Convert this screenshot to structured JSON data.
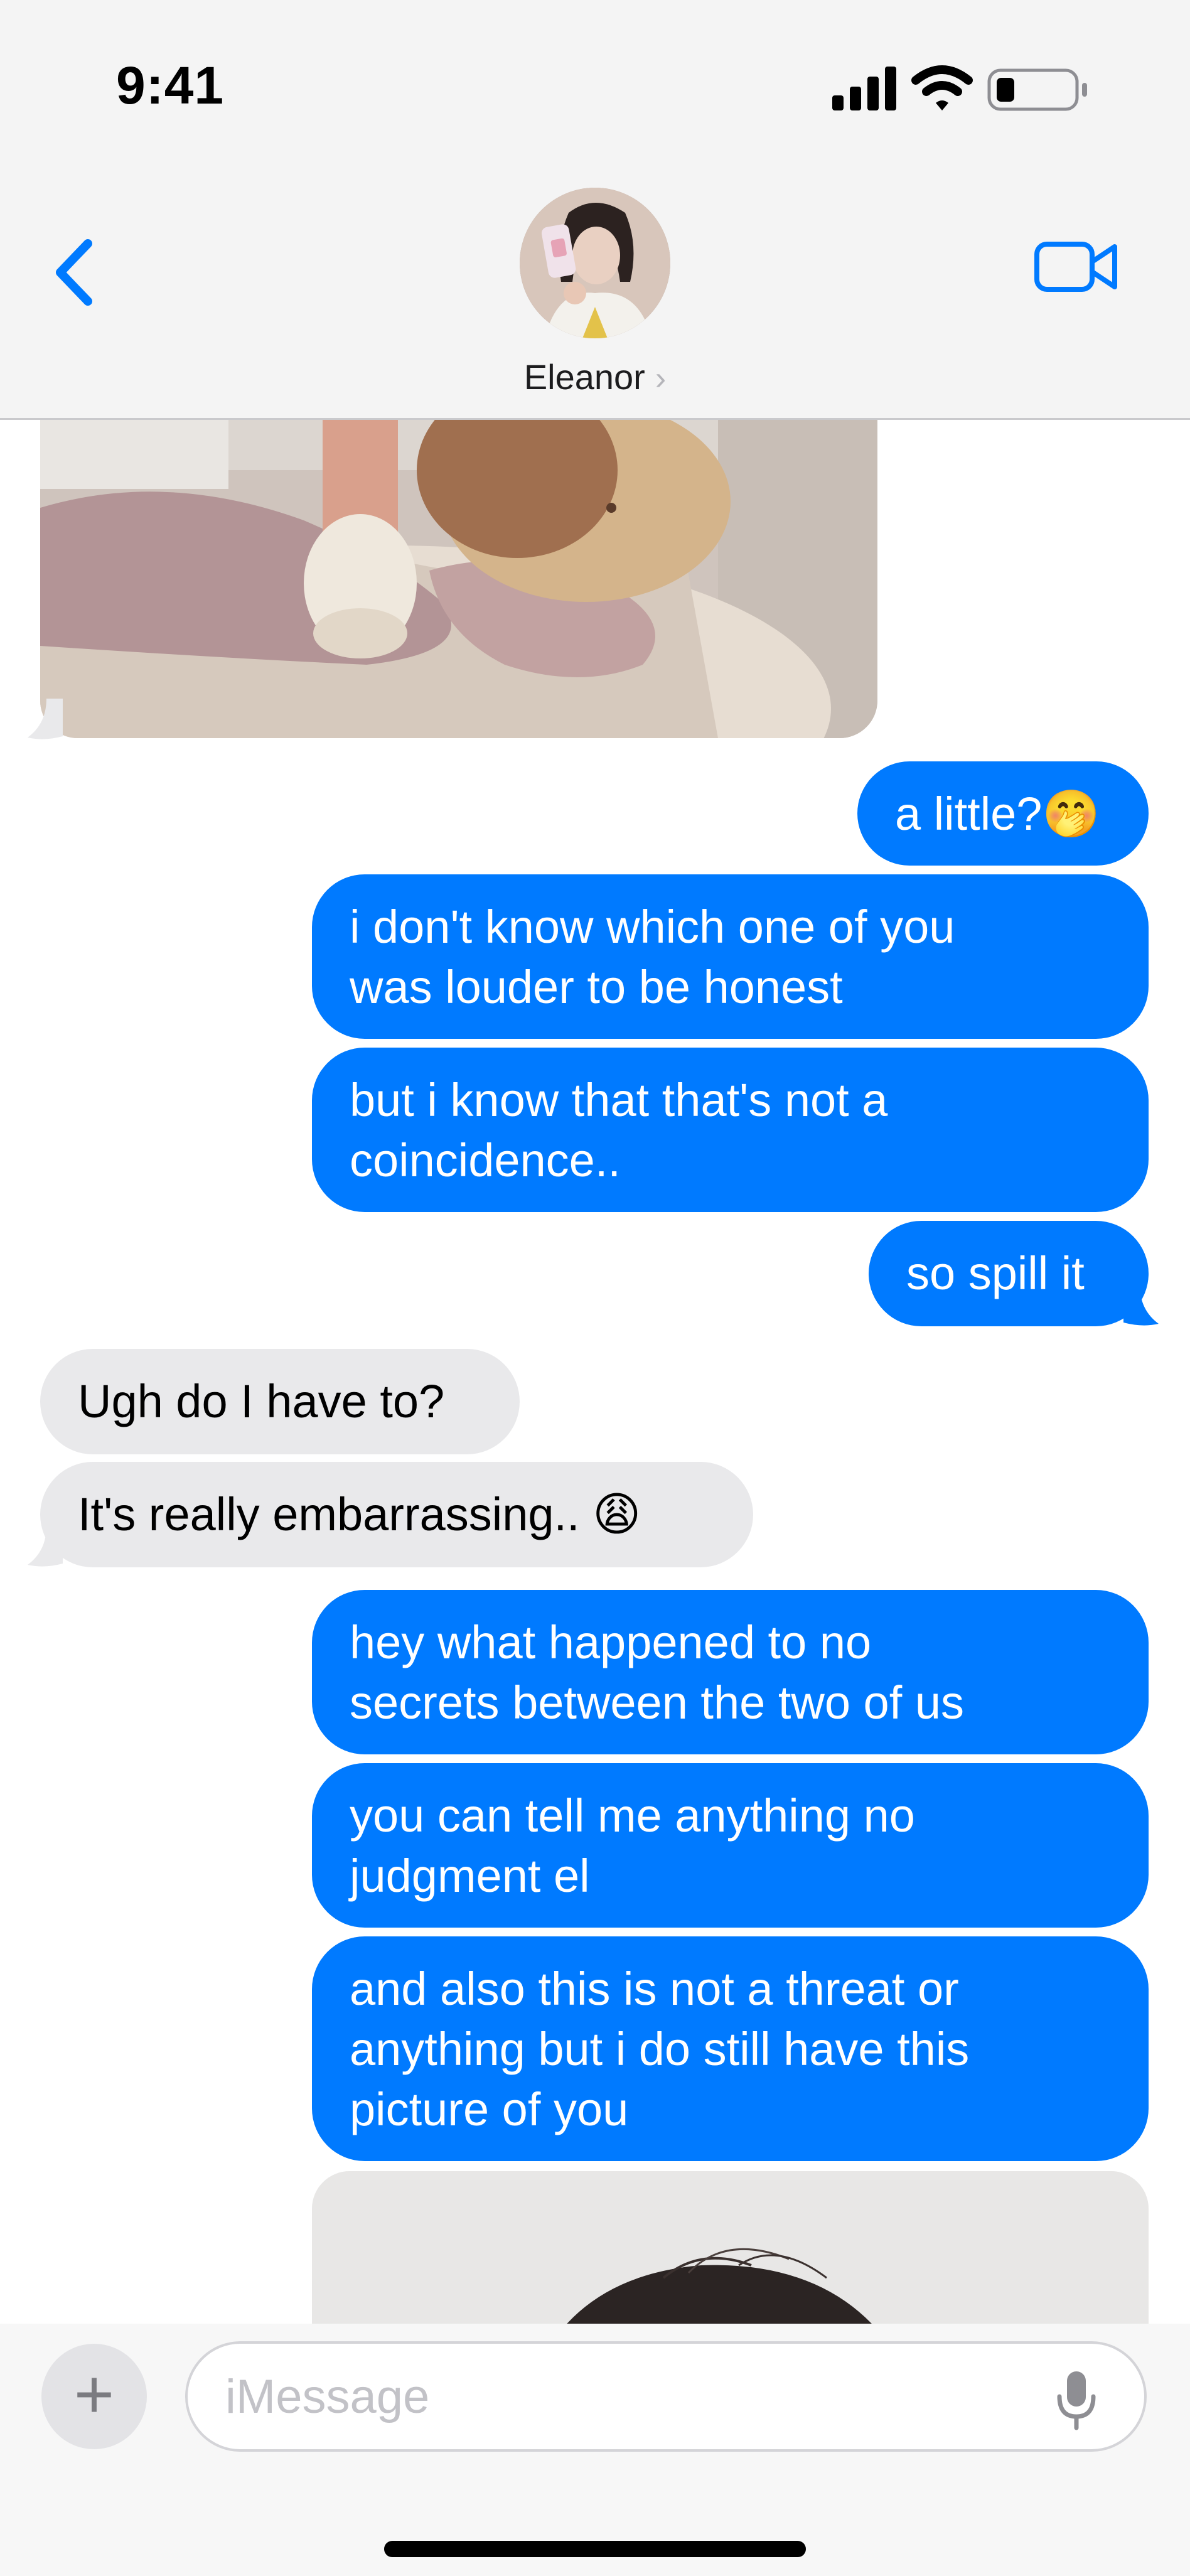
{
  "status_bar": {
    "time": "9:41",
    "icons": [
      "cellular-signal-icon",
      "wifi-icon",
      "battery-icon"
    ]
  },
  "header": {
    "contact_name": "Eleanor",
    "chevron": "›",
    "back_icon": "chevron-left-icon",
    "video_icon": "video-camera-icon"
  },
  "colors": {
    "accent": "#007aff",
    "sent_bubble": "#007aff",
    "received_bubble": "#e9e9eb"
  },
  "messages": [
    {
      "from": "them",
      "type": "image",
      "content": "photo of a bed with pink blankets and knit socks"
    },
    {
      "from": "me",
      "text": "a little?🤭"
    },
    {
      "from": "me",
      "text": "i don't know which one of you\nwas louder to be honest"
    },
    {
      "from": "me",
      "text": "but i know that that's not a\ncoincidence.."
    },
    {
      "from": "me",
      "text": "so spill it"
    },
    {
      "from": "them",
      "text": "Ugh do I have to?"
    },
    {
      "from": "them",
      "text": "It's really embarrassing.. 😩"
    },
    {
      "from": "me",
      "text": "hey what happened to no\nsecrets between the two of us"
    },
    {
      "from": "me",
      "text": "you can tell me anything no\njudgment el"
    },
    {
      "from": "me",
      "text": "and also this is not a threat or\nanything but i do still have this\npicture of you"
    },
    {
      "from": "me",
      "type": "image",
      "content": "photo of dark hair against a light wall"
    }
  ],
  "composer": {
    "plus_label": "+",
    "placeholder": "iMessage",
    "mic_icon": "microphone-icon"
  }
}
